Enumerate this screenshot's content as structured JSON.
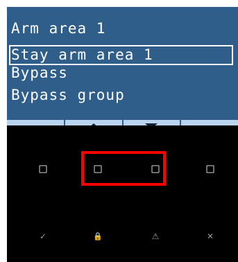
{
  "lcd": {
    "menu": [
      {
        "label": "Arm area 1",
        "selected": false
      },
      {
        "label": "Stay arm area 1",
        "selected": true
      },
      {
        "label": "Bypass",
        "selected": false
      },
      {
        "label": "Bypass group",
        "selected": false
      }
    ],
    "softkeys": [
      {
        "icon": "none"
      },
      {
        "icon": "up-arrow-icon"
      },
      {
        "icon": "down-arrow-icon"
      },
      {
        "icon": "none"
      }
    ]
  },
  "keypad": {
    "function_icons": {
      "ok": "✓",
      "lock": "🔒",
      "warning": "⚠",
      "cancel": "✕"
    }
  },
  "colors": {
    "lcd_background": "#2f5e8a",
    "softkey_bar": "#b8d4ee",
    "panel": "#000000",
    "highlight": "#ff0000"
  }
}
